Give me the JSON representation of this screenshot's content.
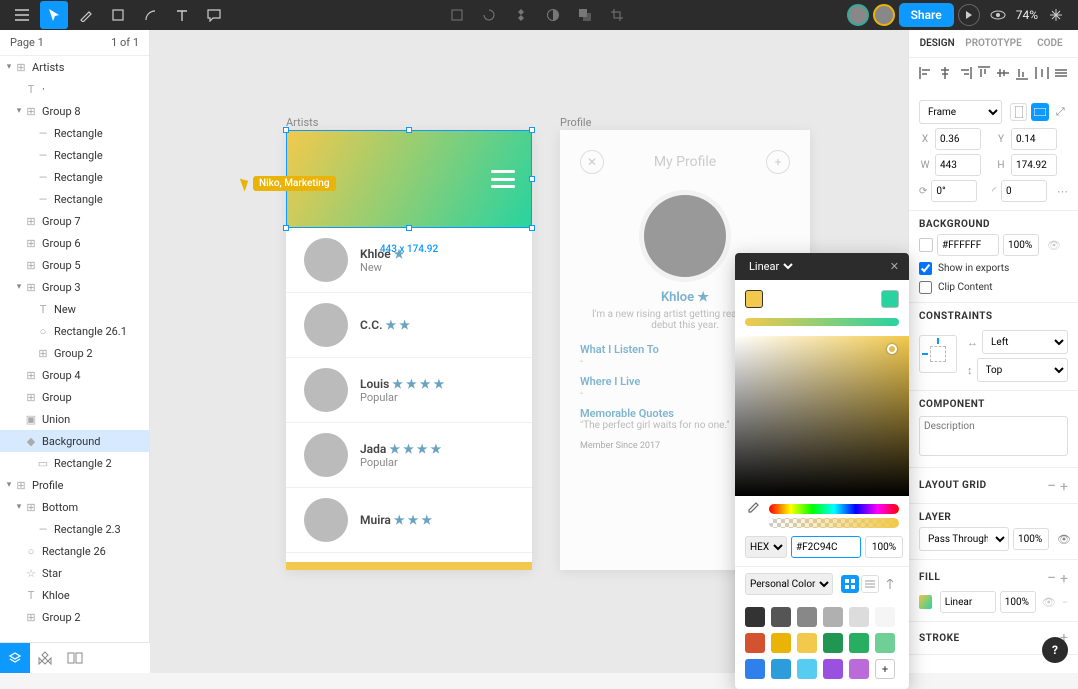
{
  "topbar": {
    "zoom": "74%",
    "share": "Share"
  },
  "pages": {
    "current": "Page 1",
    "counter": "1 of 1"
  },
  "layers": [
    {
      "label": "Artists",
      "depth": 0,
      "expanded": true,
      "icon": "frame"
    },
    {
      "label": "·",
      "depth": 1,
      "icon": "text"
    },
    {
      "label": "Group 8",
      "depth": 1,
      "expanded": true,
      "icon": "frame"
    },
    {
      "label": "Rectangle",
      "depth": 2,
      "icon": "line"
    },
    {
      "label": "Rectangle",
      "depth": 2,
      "icon": "line"
    },
    {
      "label": "Rectangle",
      "depth": 2,
      "icon": "line"
    },
    {
      "label": "Rectangle",
      "depth": 2,
      "icon": "line"
    },
    {
      "label": "Group 7",
      "depth": 1,
      "icon": "frame"
    },
    {
      "label": "Group 6",
      "depth": 1,
      "icon": "frame"
    },
    {
      "label": "Group 5",
      "depth": 1,
      "icon": "frame"
    },
    {
      "label": "Group 3",
      "depth": 1,
      "expanded": true,
      "icon": "frame"
    },
    {
      "label": "New",
      "depth": 2,
      "icon": "text"
    },
    {
      "label": "Rectangle 26.1",
      "depth": 2,
      "icon": "ellipse"
    },
    {
      "label": "Group 2",
      "depth": 2,
      "icon": "frame"
    },
    {
      "label": "Group 4",
      "depth": 1,
      "icon": "frame"
    },
    {
      "label": "Group",
      "depth": 1,
      "icon": "frame"
    },
    {
      "label": "Union",
      "depth": 1,
      "icon": "union"
    },
    {
      "label": "Background",
      "depth": 1,
      "icon": "comp",
      "selected": true
    },
    {
      "label": "Rectangle 2",
      "depth": 2,
      "icon": "rect"
    },
    {
      "label": "Profile",
      "depth": 0,
      "expanded": true,
      "icon": "frame"
    },
    {
      "label": "Bottom",
      "depth": 1,
      "expanded": true,
      "icon": "frame"
    },
    {
      "label": "Rectangle 2.3",
      "depth": 2,
      "icon": "line"
    },
    {
      "label": "Rectangle 26",
      "depth": 1,
      "icon": "ellipse"
    },
    {
      "label": "Star",
      "depth": 1,
      "icon": "star"
    },
    {
      "label": "Khloe",
      "depth": 1,
      "icon": "text"
    },
    {
      "label": "Group 2",
      "depth": 1,
      "icon": "frame"
    }
  ],
  "canvas": {
    "frame1_label": "Artists",
    "frame2_label": "Profile",
    "selection_dims": "443 x 174.92",
    "cursor_user": "Niko, Marketing",
    "artists": [
      {
        "name": "Khloe",
        "stars": "★",
        "sub": "New"
      },
      {
        "name": "C.C.",
        "stars": "★ ★",
        "sub": ""
      },
      {
        "name": "Louis",
        "stars": "★ ★ ★ ★",
        "sub": "Popular"
      },
      {
        "name": "Jada",
        "stars": "★ ★ ★ ★",
        "sub": "Popular"
      },
      {
        "name": "Muira",
        "stars": "★ ★ ★",
        "sub": ""
      }
    ],
    "profile": {
      "title": "My Profile",
      "name": "Khloe ★",
      "bio": "I'm a new rising artist getting ready for my debut this year.",
      "sec1": "What I Listen To",
      "sec2": "Where I Live",
      "sec3": "Memorable Quotes",
      "quote": "\"The perfect girl waits for no one.\"",
      "since": "Member Since 2017"
    }
  },
  "props": {
    "tab_design": "DESIGN",
    "tab_proto": "PROTOTYPE",
    "tab_code": "CODE",
    "frame_select": "Frame",
    "x": "0.36",
    "y": "0.14",
    "w": "443",
    "h": "174.92",
    "rot": "0°",
    "rad": "0",
    "bg_header": "BACKGROUND",
    "bg_hex": "#FFFFFF",
    "bg_op": "100%",
    "show_exports": "Show in exports",
    "clip": "Clip Content",
    "constraints_h": "CONSTRAINTS",
    "con_left": "Left",
    "con_top": "Top",
    "comp_h": "COMPONENT",
    "desc_ph": "Description",
    "grid_h": "LAYOUT GRID",
    "layer_h": "LAYER",
    "blend": "Pass Through",
    "layer_op": "100%",
    "fill_h": "FILL",
    "fill_type": "Linear",
    "fill_op": "100%",
    "stroke_h": "STROKE"
  },
  "picker": {
    "mode": "Linear",
    "format": "HEX",
    "hex": "#F2C94C",
    "opacity": "100%",
    "palette": "Personal Colors",
    "swatches": [
      "#333333",
      "#555555",
      "#888888",
      "#b0b0b0",
      "#dcdcdc",
      "#f5f5f5",
      "#d35230",
      "#eab308",
      "#f2c94c",
      "#219653",
      "#27ae60",
      "#6fcf97",
      "#2f80ed",
      "#2d9cdb",
      "#56ccf2",
      "#9b51e0",
      "#bb6bd9"
    ]
  },
  "help": "?"
}
